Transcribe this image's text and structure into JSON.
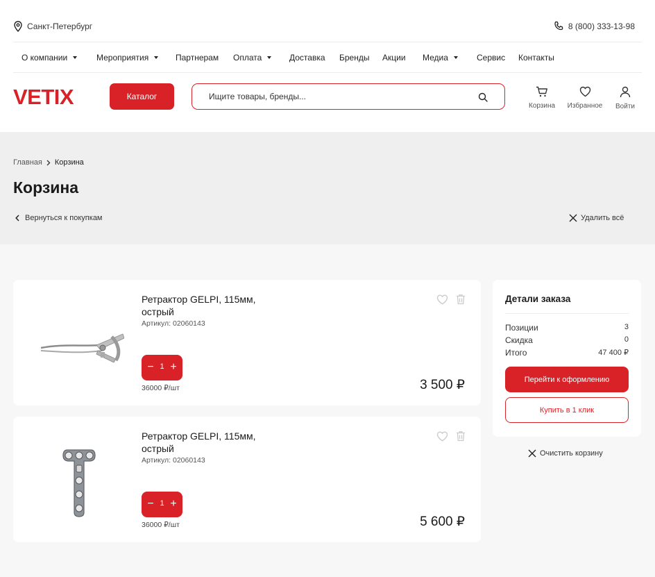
{
  "header": {
    "city": "Санкт-Петербург",
    "phone": "8 (800) 333-13-98",
    "nav": [
      {
        "label": "О компании",
        "dropdown": true
      },
      {
        "label": "Мероприятия",
        "dropdown": true
      },
      {
        "label": "Партнерам",
        "dropdown": false
      },
      {
        "label": "Оплата",
        "dropdown": true
      },
      {
        "label": "Доставка",
        "dropdown": false
      },
      {
        "label": "Бренды",
        "dropdown": false
      },
      {
        "label": "Акции",
        "dropdown": false
      },
      {
        "label": "Медиа",
        "dropdown": true
      },
      {
        "label": "Сервис",
        "dropdown": false
      },
      {
        "label": "Контакты",
        "dropdown": false
      }
    ],
    "logo": "VETIX",
    "catalog_label": "Каталог",
    "search_placeholder": "Ищите товары, бренды...",
    "actions": {
      "cart": "Корзина",
      "favorites": "Избранное",
      "login": "Войти"
    }
  },
  "page": {
    "breadcrumb": {
      "home": "Главная",
      "current": "Корзина"
    },
    "title": "Корзина",
    "back_label": "Вернуться к покупкам",
    "delete_all_label": "Удалить всё"
  },
  "cart": {
    "items": [
      {
        "name": "Ретрактор GELPI, 115мм, острый",
        "sku": "Артикул: 02060143",
        "qty": "1",
        "unit_price": "36000 ₽/шт",
        "price": "3 500 ₽",
        "image": "retractor"
      },
      {
        "name": "Ретрактор GELPI, 115мм, острый",
        "sku": "Артикул: 02060143",
        "qty": "1",
        "unit_price": "36000 ₽/шт",
        "price": "5 600 ₽",
        "image": "bone-plate"
      }
    ]
  },
  "summary": {
    "title": "Детали заказа",
    "rows": [
      {
        "label": "Позиции",
        "value": "3"
      },
      {
        "label": "Скидка",
        "value": "0"
      },
      {
        "label": "Итого",
        "value": "47 400 ₽"
      }
    ],
    "checkout_label": "Перейти к оформлению",
    "one_click_label": "Купить в 1 клик",
    "clear_label": "Очистить корзину"
  },
  "colors": {
    "accent": "#d92128",
    "band": "#efefef",
    "background": "#f7f7f7"
  }
}
